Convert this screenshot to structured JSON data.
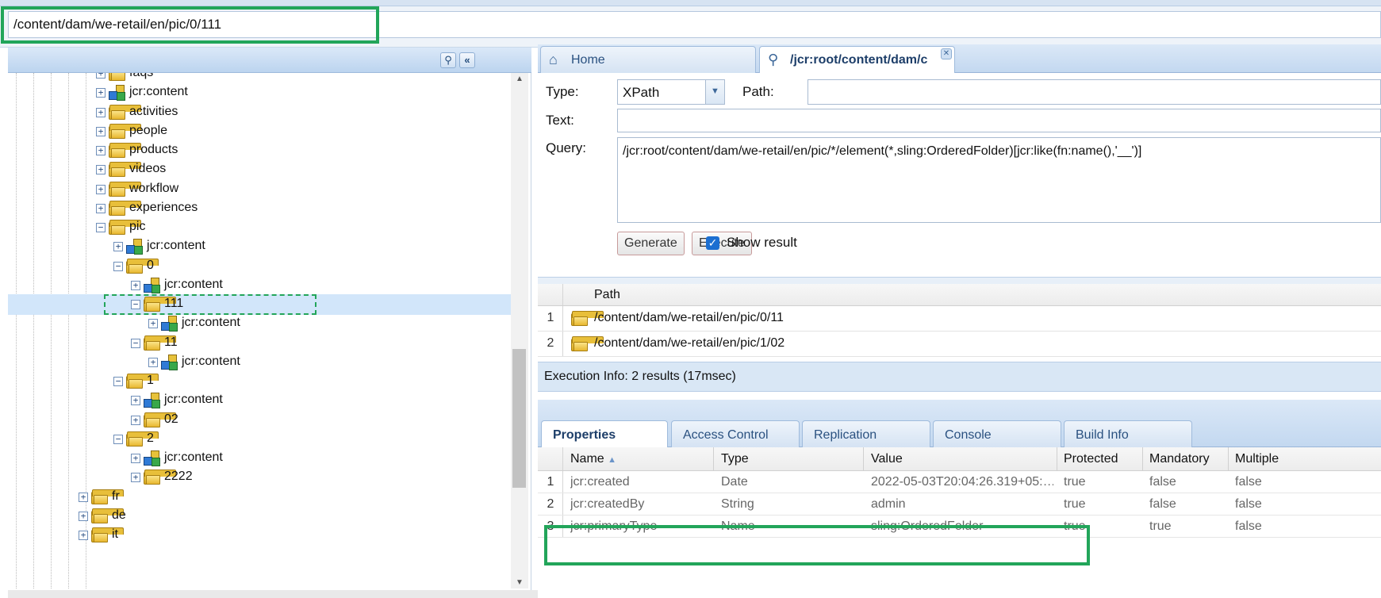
{
  "address_bar": {
    "path": "/content/dam/we-retail/en/pic/0/111"
  },
  "tree": {
    "toolbar": {
      "filter_icon": "binoculars-icon",
      "collapse_icon": "double-chevron-left-icon"
    },
    "nodes": [
      {
        "label": "faqs",
        "icon": "folder"
      },
      {
        "label": "jcr:content",
        "icon": "node"
      },
      {
        "label": "activities",
        "icon": "folder"
      },
      {
        "label": "people",
        "icon": "folder"
      },
      {
        "label": "products",
        "icon": "folder"
      },
      {
        "label": "videos",
        "icon": "folder"
      },
      {
        "label": "workflow",
        "icon": "folder"
      },
      {
        "label": "experiences",
        "icon": "folder"
      },
      {
        "label": "pic",
        "icon": "folder",
        "expanded": true
      },
      {
        "label": "jcr:content",
        "icon": "node"
      },
      {
        "label": "0",
        "icon": "folder",
        "expanded": true
      },
      {
        "label": "jcr:content",
        "icon": "node"
      },
      {
        "label": "111",
        "icon": "folder",
        "expanded": true,
        "selected": true
      },
      {
        "label": "jcr:content",
        "icon": "node"
      },
      {
        "label": "11",
        "icon": "folder",
        "expanded": true
      },
      {
        "label": "jcr:content",
        "icon": "node"
      },
      {
        "label": "1",
        "icon": "folder",
        "expanded": true
      },
      {
        "label": "jcr:content",
        "icon": "node"
      },
      {
        "label": "02",
        "icon": "folder"
      },
      {
        "label": "2",
        "icon": "folder",
        "expanded": true
      },
      {
        "label": "jcr:content",
        "icon": "node"
      },
      {
        "label": "2222",
        "icon": "folder"
      },
      {
        "label": "fr",
        "icon": "folder"
      },
      {
        "label": "de",
        "icon": "folder"
      },
      {
        "label": "it",
        "icon": "folder"
      }
    ]
  },
  "tabs": [
    {
      "label": "Home",
      "icon": "home-icon"
    },
    {
      "label": "/jcr:root/content/dam/с",
      "icon": "search-icon",
      "active": true
    }
  ],
  "query_form": {
    "type_label": "Type:",
    "type_value": "XPath",
    "path_label": "Path:",
    "path_value": "",
    "text_label": "Text:",
    "text_value": "",
    "query_label": "Query:",
    "query_value": "/jcr:root/content/dam/we-retail/en/pic/*/element(*,sling:OrderedFolder)[jcr:like(fn:name(),'__')]",
    "generate_label": "Generate",
    "execute_label": "Execute",
    "show_result_label": "Show result",
    "show_result_checked": true
  },
  "results": {
    "column": "Path",
    "rows": [
      {
        "num": "1",
        "path": "/content/dam/we-retail/en/pic/0/11"
      },
      {
        "num": "2",
        "path": "/content/dam/we-retail/en/pic/1/02"
      }
    ],
    "execution_info": "Execution Info: 2 results (17msec)"
  },
  "properties": {
    "tabs": [
      "Properties",
      "Access Control",
      "Replication",
      "Console",
      "Build Info"
    ],
    "active_tab": "Properties",
    "columns": [
      "Name",
      "Type",
      "Value",
      "Protected",
      "Mandatory",
      "Multiple"
    ],
    "sort_indicator": "▲",
    "rows": [
      {
        "num": "1",
        "name": "jcr:created",
        "type": "Date",
        "value": "2022-05-03T20:04:26.319+05:…",
        "protected": "true",
        "mandatory": "false",
        "multiple": "false"
      },
      {
        "num": "2",
        "name": "jcr:createdBy",
        "type": "String",
        "value": "admin",
        "protected": "true",
        "mandatory": "false",
        "multiple": "false"
      },
      {
        "num": "3",
        "name": "jcr:primaryType",
        "type": "Name",
        "value": "sling:OrderedFolder",
        "protected": "true",
        "mandatory": "true",
        "multiple": "false"
      }
    ]
  },
  "colors": {
    "highlight": "#22a55a",
    "panel_header": "#c3d8f0",
    "selection": "#d2e6fa"
  }
}
